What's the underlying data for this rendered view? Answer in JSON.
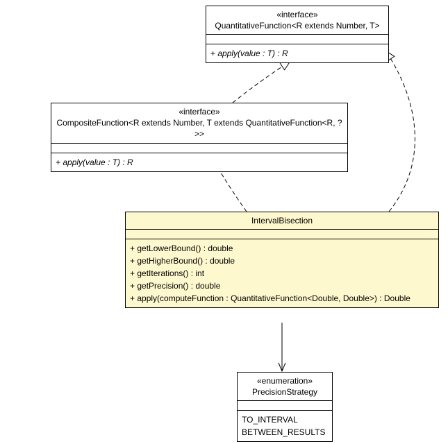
{
  "quantitativeFunction": {
    "stereotype": "«interface»",
    "name": "QuantitativeFunction<R extends Number, T>",
    "method": "+ apply(value : T) : R"
  },
  "compositeFunction": {
    "stereotype": "«interface»",
    "name": "CompositeFunction<R extends Number, T extends QuantitativeFunction<R, ?>>",
    "method": "+ apply(value : T) : R"
  },
  "intervalBisection": {
    "name": "IntervalBisection",
    "methods": [
      "+ getLowerBound() : double",
      "+ getHigherBound() : double",
      "+ getIterations() : int",
      "+ getPrecision() : double",
      "+ apply(computeFunction : QuantitativeFunction<Double, Double>) : Double"
    ]
  },
  "precisionStrategy": {
    "stereotype": "«enumeration»",
    "name": "PrecisionStrategy",
    "values": [
      "TO_INTERVAL",
      "BETWEEN_RESULTS"
    ]
  },
  "chart_data": {
    "type": "uml-class-diagram",
    "classes": [
      {
        "id": "QuantitativeFunction",
        "kind": "interface",
        "generics": "<R extends Number, T>",
        "members": [
          "+ apply(value : T) : R"
        ]
      },
      {
        "id": "CompositeFunction",
        "kind": "interface",
        "generics": "<R extends Number, T extends QuantitativeFunction<R, ?>>",
        "members": [
          "+ apply(value : T) : R"
        ]
      },
      {
        "id": "IntervalBisection",
        "kind": "class",
        "members": [
          "+ getLowerBound() : double",
          "+ getHigherBound() : double",
          "+ getIterations() : int",
          "+ getPrecision() : double",
          "+ apply(computeFunction : QuantitativeFunction<Double, Double>) : Double"
        ]
      },
      {
        "id": "PrecisionStrategy",
        "kind": "enumeration",
        "members": [
          "TO_INTERVAL",
          "BETWEEN_RESULTS"
        ]
      }
    ],
    "relationships": [
      {
        "from": "CompositeFunction",
        "to": "QuantitativeFunction",
        "type": "realization"
      },
      {
        "from": "IntervalBisection",
        "to": "CompositeFunction",
        "type": "realization"
      },
      {
        "from": "IntervalBisection",
        "to": "QuantitativeFunction",
        "type": "realization"
      },
      {
        "from": "IntervalBisection",
        "to": "PrecisionStrategy",
        "type": "association",
        "navigability": "to"
      }
    ]
  }
}
